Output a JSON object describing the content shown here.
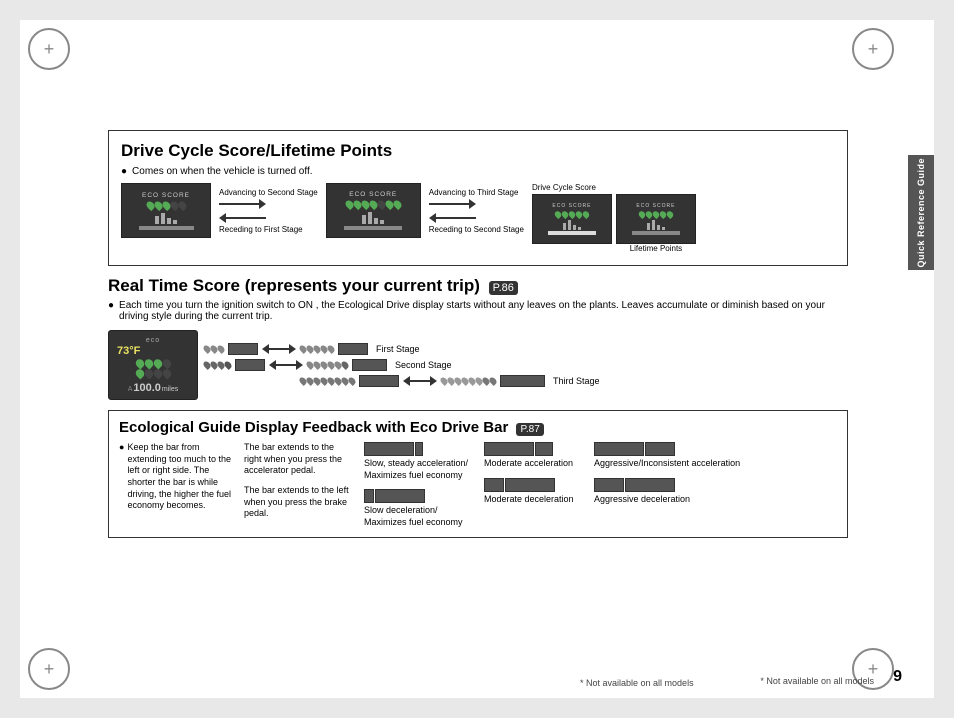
{
  "page": {
    "background_color": "#e0e0e0",
    "page_number": "9",
    "footnote": "* Not available on all models"
  },
  "sidebar": {
    "label": "Quick Reference Guide",
    "background": "#555555"
  },
  "drive_cycle_section": {
    "title": "Drive Cycle Score/Lifetime Points",
    "bullet": "Comes on when the vehicle is turned off.",
    "diagram1_label": "eco SCORE",
    "diagram1_caption_top": "Advancing to Second Stage",
    "diagram1_caption_bottom": "Receding to First Stage",
    "diagram2_label": "eco SCORE",
    "diagram2_caption_top": "Advancing to Third Stage",
    "diagram2_caption_bottom": "Receding to Second Stage",
    "diagram3_label": "eco SCORE",
    "diagram3_drive_cycle_label": "Drive Cycle Score",
    "diagram3_lifetime_label": "Lifetime Points"
  },
  "real_time_section": {
    "title": "Real Time Score (represents your current trip)",
    "page_ref": "P.86",
    "bullet": "Each time you turn the ignition switch to ON , the Ecological Drive display starts without any leaves on the plants. Leaves accumulate or diminish based on your driving style during the current trip.",
    "first_stage_label": "First Stage",
    "second_stage_label": "Second Stage",
    "third_stage_label": "Third Stage"
  },
  "eco_guide_section": {
    "title": "Ecological Guide Display Feedback with Eco Drive Bar",
    "page_ref": "P.87",
    "col1_text": "Keep the bar from extending too much to the left or right side. The shorter the bar is while driving, the higher the fuel economy becomes.",
    "col2_top_text": "The bar extends to the right when you press the accelerator pedal.",
    "col2_bottom_text": "The bar extends to the left when you press the brake pedal.",
    "col3_top_label": "Slow, steady acceleration/ Maximizes fuel economy",
    "col3_bottom_label": "Slow deceleration/ Maximizes fuel economy",
    "col4_top_label": "Moderate acceleration",
    "col4_bottom_label": "Moderate deceleration",
    "col5_top_label": "Aggressive/Inconsistent acceleration",
    "col5_bottom_label": "Aggressive deceleration"
  }
}
